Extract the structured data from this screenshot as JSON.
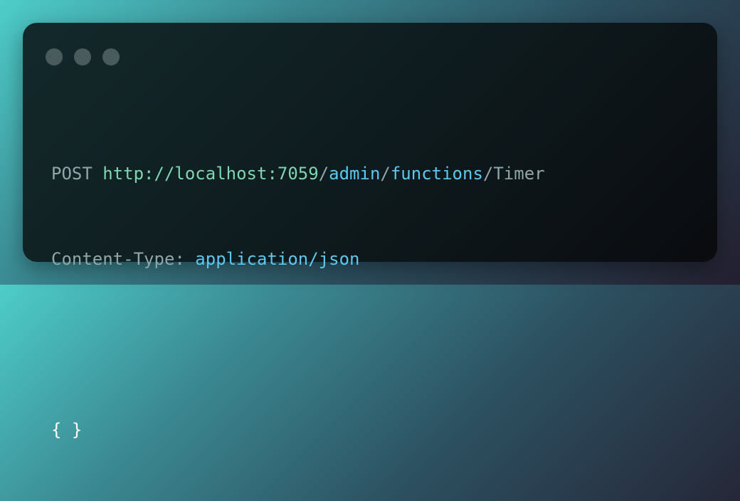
{
  "window": {
    "dots": [
      "close",
      "minimize",
      "maximize"
    ]
  },
  "request": {
    "method": "POST",
    "url_base": "http://localhost:7059",
    "slash1": "/",
    "seg1": "admin",
    "slash2": "/",
    "seg2": "functions",
    "slash3": "/",
    "seg3": "Timer",
    "header_name": "Content-Type:",
    "header_value": "application/json",
    "body": "{ }"
  },
  "colors": {
    "method": "#8fa7a8",
    "url": "#7ed6b0",
    "path": "#5cc8f0",
    "body": "#ffffff"
  }
}
